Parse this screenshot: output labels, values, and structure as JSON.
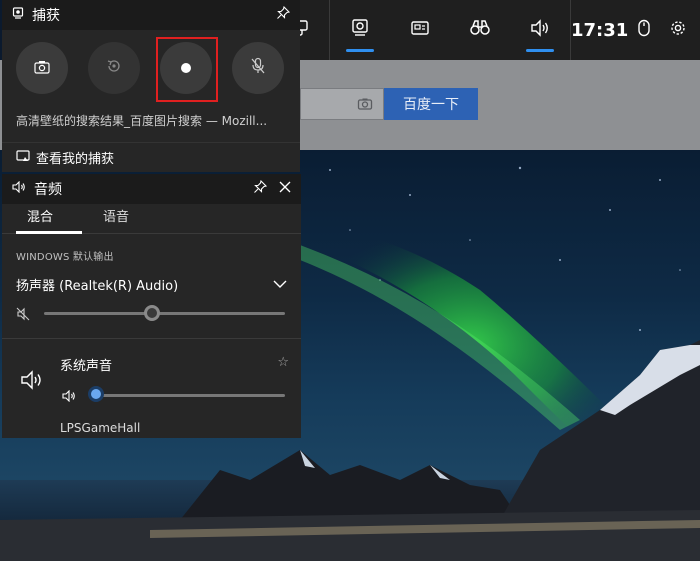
{
  "browser": {
    "search_button": "百度一下"
  },
  "gamebar": {
    "time": "17:31",
    "icons": [
      "widget-menu-icon",
      "capture-icon",
      "performance-icon",
      "xbox-social-icon",
      "audio-icon",
      "mouse-icon",
      "settings-icon"
    ]
  },
  "capture": {
    "title": "捕获",
    "window_name": "高清壁纸的搜索结果_百度图片搜索 — Mozill...",
    "gallery_label": "查看我的捕获",
    "buttons": [
      "screenshot-icon",
      "record-last-30-icon",
      "record-icon",
      "mic-off-icon"
    ]
  },
  "audio": {
    "title": "音频",
    "tabs": [
      {
        "label": "混合"
      },
      {
        "label": "语音"
      }
    ],
    "section_label": "WINDOWS 默认输出",
    "device": "扬声器 (Realtek(R) Audio)",
    "master_volume": 0.45,
    "app": {
      "name": "系统声音",
      "volume": 0.0
    },
    "next_app": "LPSGameHall"
  },
  "colors": {
    "accent": "#2f8fef",
    "highlight": "#e02020",
    "panel": "#262626"
  }
}
